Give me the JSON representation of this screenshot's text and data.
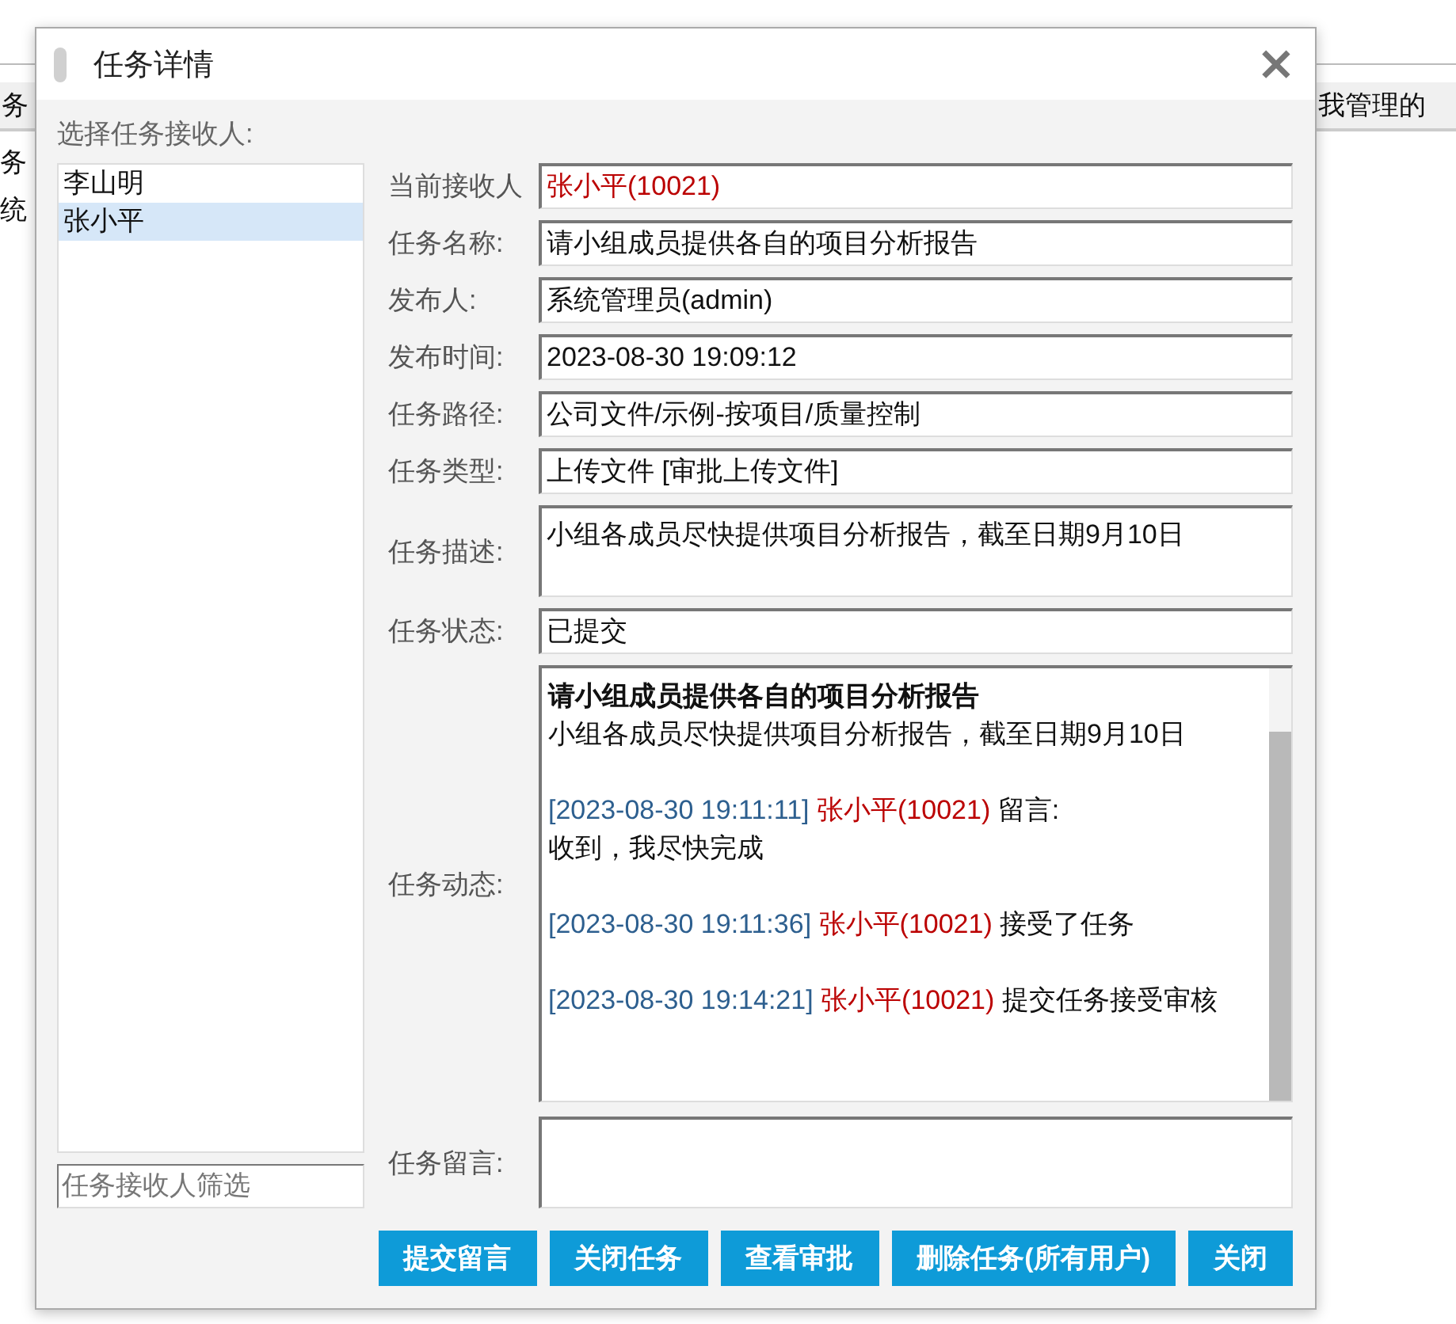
{
  "background": {
    "tabs": [
      {
        "label": "务",
        "selected": false
      },
      {
        "label": "我管理的",
        "selected": false
      }
    ],
    "lines": [
      "务",
      "统"
    ]
  },
  "dialog": {
    "title": "任务详情",
    "close": "×",
    "recipients": {
      "label": "选择任务接收人:",
      "items": [
        {
          "name": "李山明",
          "selected": false
        },
        {
          "name": "张小平",
          "selected": true
        }
      ],
      "filter": {
        "placeholder": "任务接收人筛选"
      }
    },
    "fields": [
      {
        "kind": "person",
        "label": "当前接收人",
        "value": "张小平(10021)"
      },
      {
        "kind": "text",
        "label": "任务名称:",
        "value": "请小组成员提供各自的项目分析报告"
      },
      {
        "kind": "text",
        "label": "发布人:",
        "value": "系统管理员(admin)"
      },
      {
        "kind": "text",
        "label": "发布时间:",
        "value": "2023-08-30 19:09:12"
      },
      {
        "kind": "text",
        "label": "任务路径:",
        "value": "公司文件/示例-按项目/质量控制"
      },
      {
        "kind": "text",
        "label": "任务类型:",
        "value": "上传文件 [审批上传文件]"
      },
      {
        "kind": "multiline",
        "label": "任务描述:",
        "value": "小组各成员尽快提供项目分析报告，截至日期9月10日"
      },
      {
        "kind": "text",
        "label": "任务状态:",
        "value": "已提交"
      }
    ],
    "activity": {
      "label": "任务动态:",
      "title": "请小组成员提供各自的项目分析报告",
      "description": "小组各成员尽快提供项目分析报告，截至日期9月10日",
      "entries": [
        {
          "time": "[2023-08-30 19:11:11]",
          "user": "张小平(10021)",
          "action": "留言:",
          "message": "收到，我尽快完成"
        },
        {
          "time": "[2023-08-30 19:11:36]",
          "user": "张小平(10021)",
          "action": "接受了任务"
        },
        {
          "time": "[2023-08-30 19:14:21]",
          "user": "张小平(10021)",
          "action": "提交任务接受审核"
        }
      ]
    },
    "message": {
      "label": "任务留言:"
    },
    "buttons": [
      "提交留言",
      "关闭任务",
      "查看审批",
      "删除任务(所有用户)",
      "关闭"
    ]
  }
}
